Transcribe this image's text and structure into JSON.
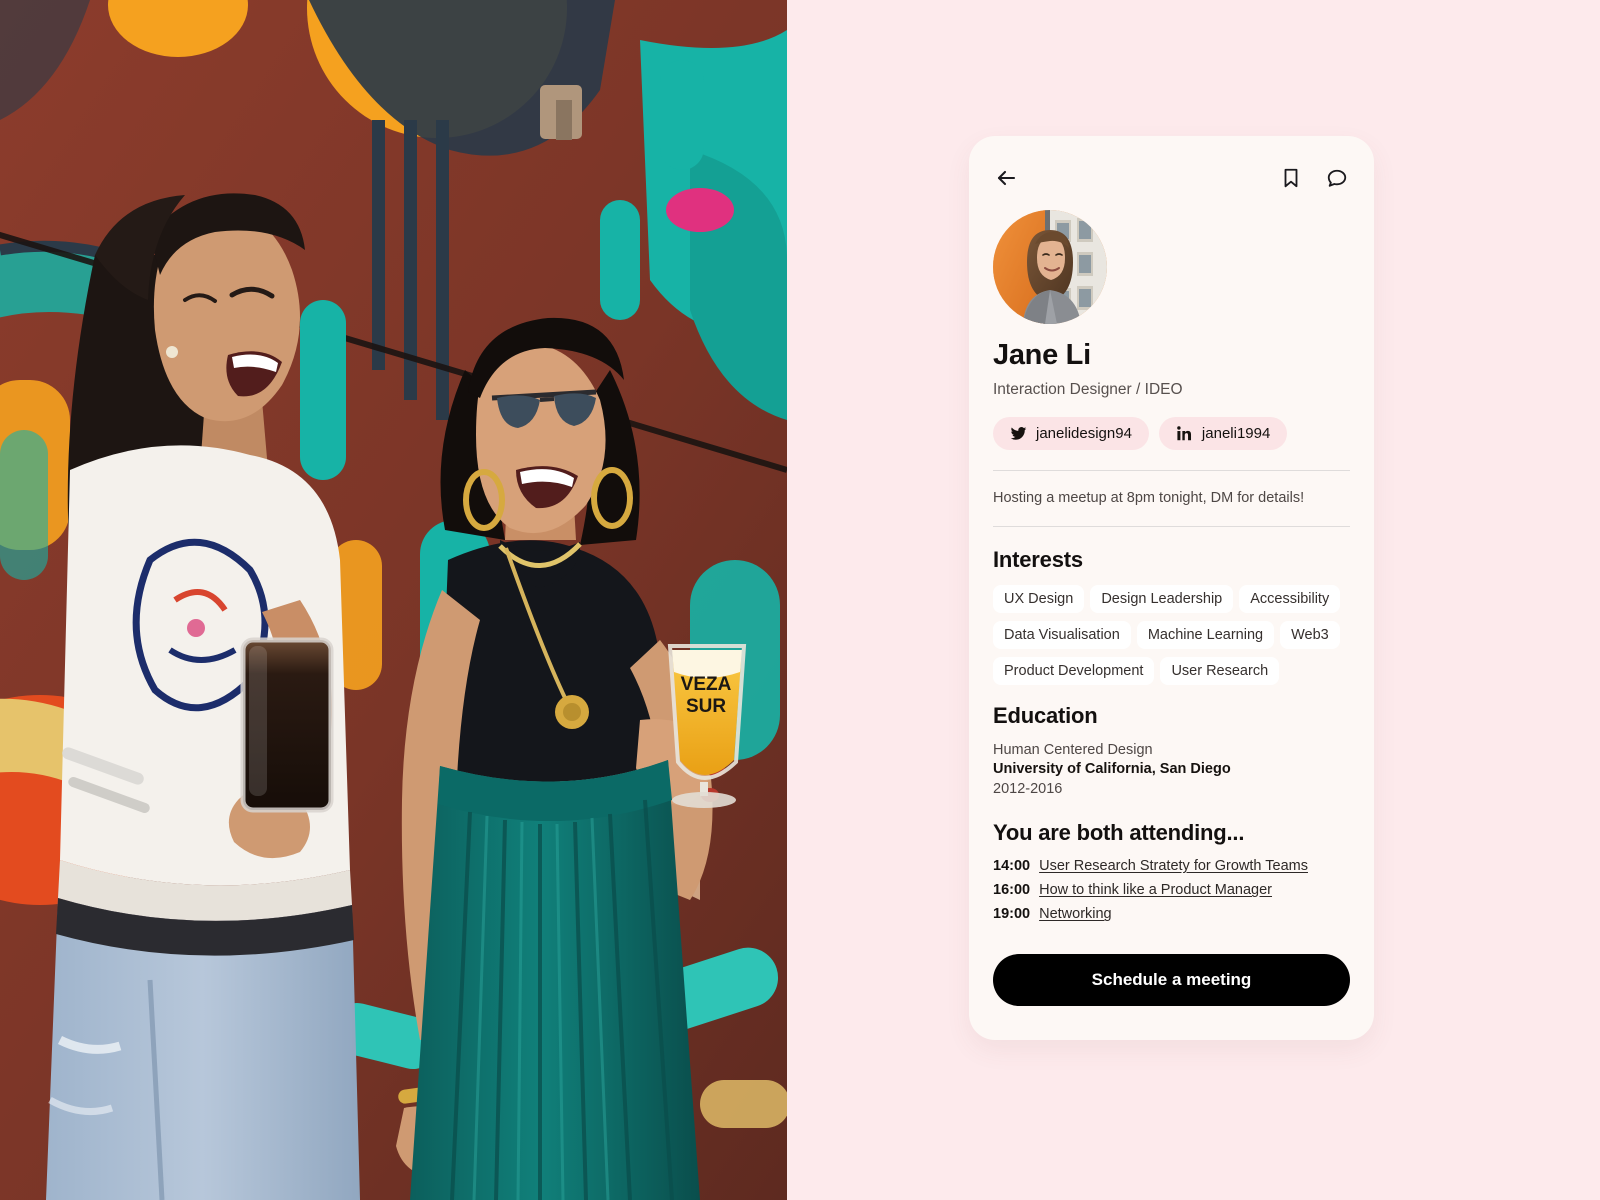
{
  "theme": {
    "page_background": "#FDEAEC",
    "card_background": "#FDF8F5",
    "pill_background": "#FBE4E6",
    "tag_background": "#FFFFFF",
    "cta_background": "#000000",
    "cta_text_color": "#FFFFFF",
    "divider_color": "#DFDCDB",
    "heading_color": "#13100F",
    "muted_text_color": "#57504E"
  },
  "photo": {
    "name": "two-women-laughing-by-mural",
    "description": "Two smiling women holding drinks in front of a colorful street mural",
    "glass_label": "VEZA SUR",
    "mural_colors": [
      "#8A3A2B",
      "#F5A11F",
      "#17B3A6",
      "#E34B1F",
      "#2B3A48",
      "#E6C36B",
      "#6F3F2E"
    ]
  },
  "card": {
    "actions": {
      "back": {
        "icon": "arrow-left-icon",
        "label": "Back"
      },
      "bookmark": {
        "icon": "bookmark-icon",
        "label": "Bookmark"
      },
      "message": {
        "icon": "chat-bubble-icon",
        "label": "Message"
      }
    },
    "avatar": {
      "icon": "profile-photo",
      "alt": "Jane Li portrait"
    },
    "name": "Jane Li",
    "role": "Interaction Designer / IDEO",
    "socials": [
      {
        "platform": "twitter",
        "icon": "twitter-icon",
        "handle": "janelidesign94"
      },
      {
        "platform": "linkedin",
        "icon": "linkedin-icon",
        "handle": "janeli1994"
      }
    ],
    "status": "Hosting a meetup at 8pm tonight, DM for details!",
    "interests": {
      "title": "Interests",
      "tags": [
        "UX Design",
        "Design Leadership",
        "Accessibility",
        "Data Visualisation",
        "Machine Learning",
        "Web3",
        "Product Development",
        "User Research"
      ]
    },
    "education": {
      "title": "Education",
      "field": "Human Centered Design",
      "institution": "University of California, San Diego",
      "years": "2012-2016"
    },
    "attending": {
      "title": "You are both attending...",
      "sessions": [
        {
          "time": "14:00",
          "name": "User Research Stratety for Growth Teams"
        },
        {
          "time": "16:00",
          "name": "How to think like a Product Manager"
        },
        {
          "time": "19:00",
          "name": "Networking"
        }
      ]
    },
    "cta_label": "Schedule a meeting"
  }
}
